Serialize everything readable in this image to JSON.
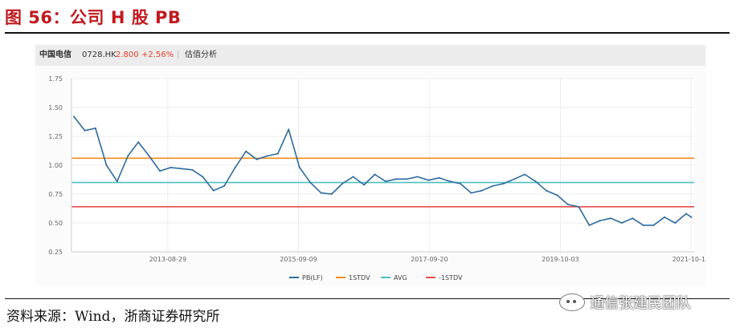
{
  "figure": {
    "title": "图 56：公司 H 股 PB",
    "source": "资料来源：Wind，浙商证券研究所",
    "watermark": "通信张建民团队"
  },
  "header": {
    "name": "中国电信",
    "code": "0728.HK",
    "price": "2.800",
    "change": "+2.56%",
    "tab": "估值分析"
  },
  "colors": {
    "pb": "#2e6b9e",
    "stdv_plus": "#f08c1e",
    "avg": "#4fbfbf",
    "stdv_minus": "#e84d4d"
  },
  "chart_data": {
    "type": "line",
    "ylim": [
      0.25,
      1.75
    ],
    "yticks": [
      "1.75",
      "1.50",
      "1.25",
      "1.00",
      "0.75",
      "0.50",
      "0.25"
    ],
    "xticks": [
      "2013-08-29",
      "2015-09-09",
      "2017-09-20",
      "2019-10-03",
      "2021-10-12"
    ],
    "xrange": [
      "2012-03-01",
      "2021-10-31"
    ],
    "grid": true,
    "legend_position": "bottom",
    "reference_lines": [
      {
        "name": "1STDV",
        "value": 1.06
      },
      {
        "name": "AVG",
        "value": 0.85
      },
      {
        "name": "-1STDV",
        "value": 0.64
      }
    ],
    "series": [
      {
        "name": "PB(LF)",
        "x": [
          "2012-03",
          "2012-05",
          "2012-07",
          "2012-09",
          "2012-11",
          "2013-01",
          "2013-03",
          "2013-05",
          "2013-07",
          "2013-09",
          "2013-11",
          "2014-01",
          "2014-03",
          "2014-05",
          "2014-07",
          "2014-09",
          "2014-11",
          "2015-01",
          "2015-03",
          "2015-05",
          "2015-07",
          "2015-09",
          "2015-11",
          "2016-01",
          "2016-03",
          "2016-05",
          "2016-07",
          "2016-09",
          "2016-11",
          "2017-01",
          "2017-03",
          "2017-05",
          "2017-07",
          "2017-09",
          "2017-11",
          "2018-01",
          "2018-03",
          "2018-05",
          "2018-07",
          "2018-09",
          "2018-11",
          "2019-01",
          "2019-03",
          "2019-05",
          "2019-07",
          "2019-09",
          "2019-11",
          "2020-01",
          "2020-03",
          "2020-05",
          "2020-07",
          "2020-09",
          "2020-11",
          "2021-01",
          "2021-03",
          "2021-05",
          "2021-07",
          "2021-09",
          "2021-10"
        ],
        "values": [
          1.42,
          1.3,
          1.32,
          1.0,
          0.86,
          1.08,
          1.2,
          1.08,
          0.95,
          0.98,
          0.97,
          0.96,
          0.9,
          0.78,
          0.82,
          0.98,
          1.12,
          1.05,
          1.08,
          1.1,
          1.31,
          0.98,
          0.85,
          0.76,
          0.75,
          0.84,
          0.9,
          0.83,
          0.92,
          0.86,
          0.88,
          0.88,
          0.9,
          0.87,
          0.89,
          0.86,
          0.84,
          0.76,
          0.78,
          0.82,
          0.84,
          0.88,
          0.92,
          0.86,
          0.78,
          0.74,
          0.66,
          0.64,
          0.48,
          0.52,
          0.54,
          0.5,
          0.54,
          0.48,
          0.48,
          0.55,
          0.5,
          0.58,
          0.55
        ]
      }
    ]
  }
}
